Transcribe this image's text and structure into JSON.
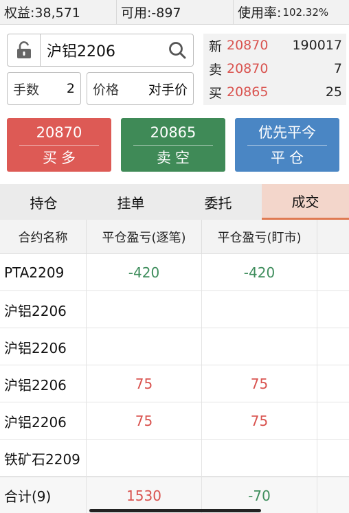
{
  "topbar": {
    "equity": "权益:38,571",
    "available": "可用:-897",
    "usage_label": "使用率:",
    "usage_value": "102.32%"
  },
  "order": {
    "symbol": "沪铝2206",
    "qty_label": "手数",
    "qty_value": "2",
    "price_label": "价格",
    "price_value": "对手价"
  },
  "quote": [
    {
      "key": "新",
      "price": "20870",
      "volume": "190017"
    },
    {
      "key": "卖",
      "price": "20870",
      "volume": "7"
    },
    {
      "key": "买",
      "price": "20865",
      "volume": "25"
    }
  ],
  "buttons": {
    "buy": {
      "price": "20870",
      "label": "买多"
    },
    "sell": {
      "price": "20865",
      "label": "卖空"
    },
    "close": {
      "price": "优先平今",
      "label": "平仓"
    }
  },
  "tabs": [
    "持仓",
    "挂单",
    "委托",
    "成交"
  ],
  "active_tab": "成交",
  "table": {
    "headers": [
      "合约名称",
      "平仓盈亏(逐笔)",
      "平仓盈亏(盯市)"
    ],
    "rows": [
      {
        "name": "PTA2209",
        "pnl_trade": "-420",
        "pnl_mark": "-420"
      },
      {
        "name": "沪铝2206",
        "pnl_trade": "",
        "pnl_mark": ""
      },
      {
        "name": "沪铝2206",
        "pnl_trade": "",
        "pnl_mark": ""
      },
      {
        "name": "沪铝2206",
        "pnl_trade": "75",
        "pnl_mark": "75"
      },
      {
        "name": "沪铝2206",
        "pnl_trade": "75",
        "pnl_mark": "75"
      },
      {
        "name": "铁矿石2209",
        "pnl_trade": "",
        "pnl_mark": ""
      }
    ],
    "total": {
      "name": "合计(9)",
      "pnl_trade": "1530",
      "pnl_mark": "-70"
    }
  },
  "colors": {
    "buy": "#dd5a55",
    "sell": "#3f8a57",
    "close": "#4a86c4",
    "profit": "#d9534f",
    "loss": "#3e8d5c",
    "active_tab": "#f3d6cb"
  },
  "icons": {
    "lock": "lock-open-icon",
    "search": "search-icon"
  }
}
